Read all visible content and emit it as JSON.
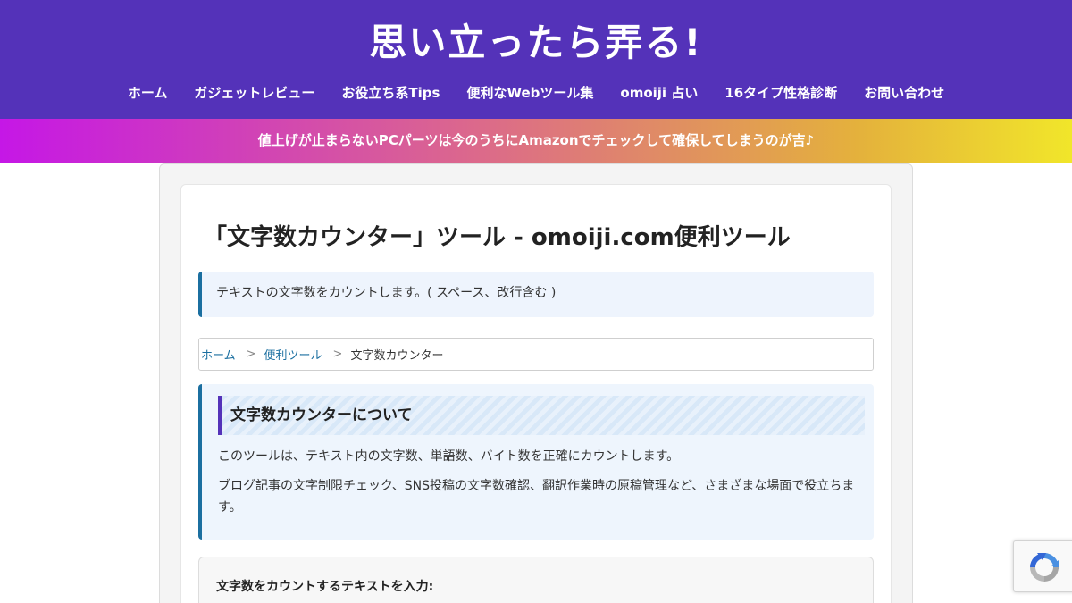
{
  "header": {
    "site_title": "思い立ったら弄る!",
    "nav": [
      {
        "label": "ホーム"
      },
      {
        "label": "ガジェットレビュー"
      },
      {
        "label": "お役立ち系Tips"
      },
      {
        "label": "便利なWebツール集"
      },
      {
        "label": "omoiji 占い"
      },
      {
        "label": "16タイプ性格診断"
      },
      {
        "label": "お問い合わせ"
      }
    ]
  },
  "notice": {
    "text": "値上げが止まらないPCパーツは今のうちにAmazonでチェックして確保してしまうのが吉♪"
  },
  "page": {
    "title": "「文字数カウンター」ツール - omoiji.com便利ツール",
    "description": "テキストの文字数をカウントします。( スペース、改行含む )"
  },
  "breadcrumb": {
    "home": "ホーム",
    "sep1": ">",
    "tools": "便利ツール",
    "sep2": ">",
    "current": "文字数カウンター"
  },
  "about": {
    "heading": "文字数カウンターについて",
    "p1": "このツールは、テキスト内の文字数、単語数、バイト数を正確にカウントします。",
    "p2": "ブログ記事の文字制限チェック、SNS投稿の文字数確認、翻訳作業時の原稿管理など、さまざまな場面で役立ちます。"
  },
  "input": {
    "label": "文字数をカウントするテキストを入力:"
  },
  "colors": {
    "header_bg": "#5432b9",
    "accent_blue": "#1b6fa0",
    "notice_gradient_start": "#c517e6",
    "notice_gradient_end": "#f1e62a"
  },
  "icons": {
    "recaptcha": "recaptcha-icon"
  }
}
